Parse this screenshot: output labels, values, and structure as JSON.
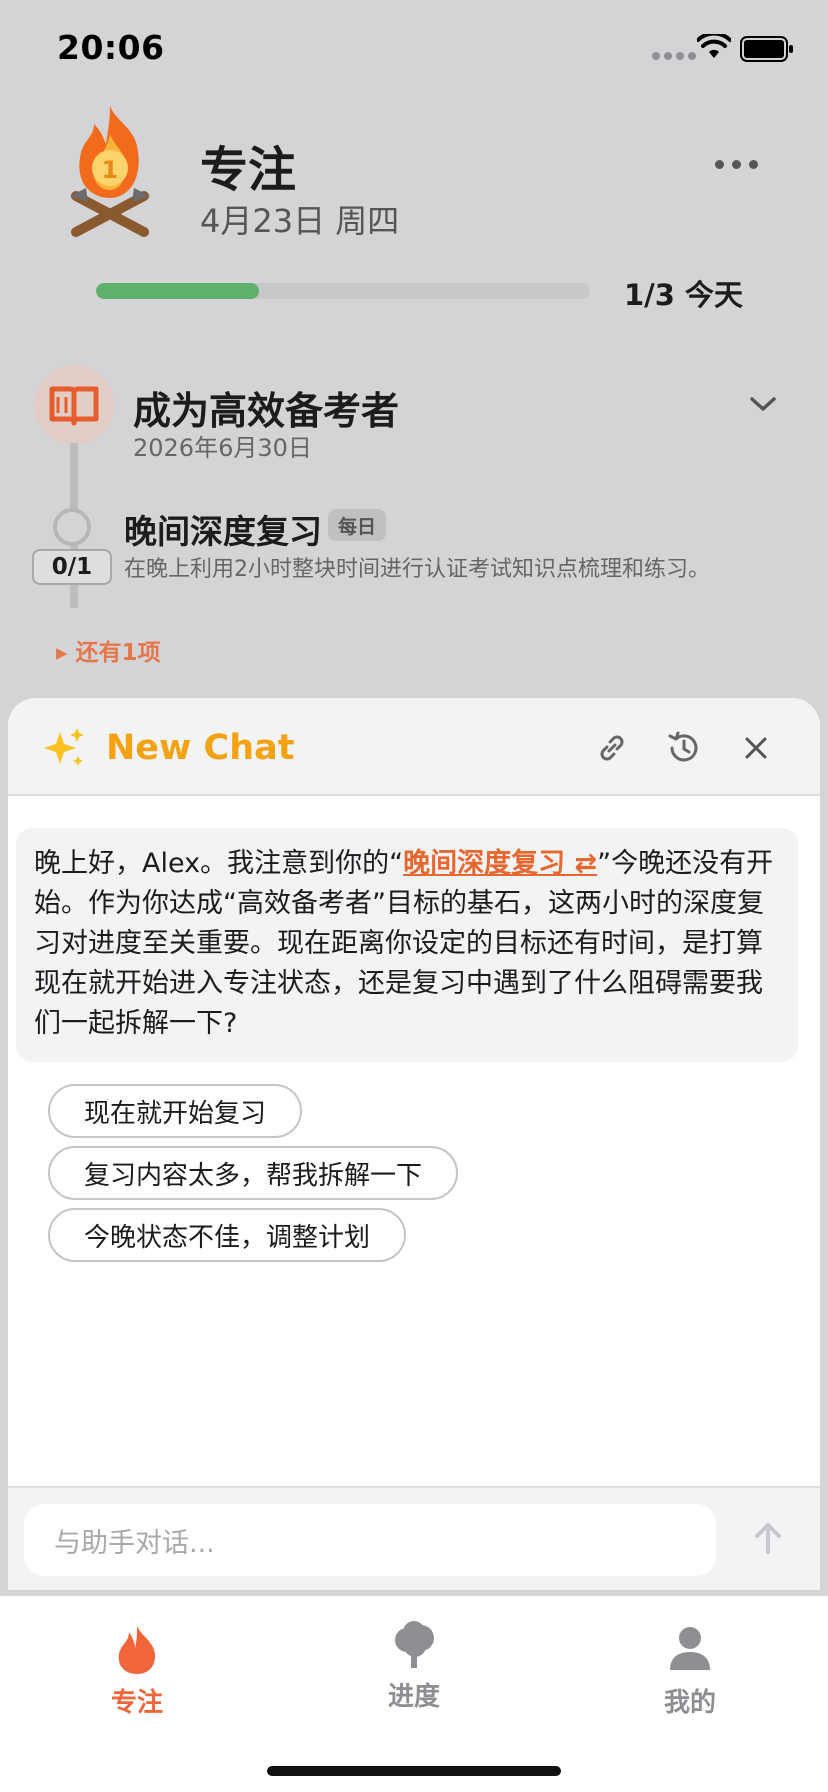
{
  "status_bar": {
    "time": "20:06"
  },
  "header": {
    "title": "专注",
    "date": "4月23日 周四",
    "progress_text": "1/3 今天",
    "progress_fraction": 0.33
  },
  "goal": {
    "title": "成为高效备考者",
    "due_date": "2026年6月30日",
    "task": {
      "title": "晚间深度复习",
      "tag": "每日",
      "count": "0/1",
      "description": "在晚上利用2小时整块时间进行认证考试知识点梳理和练习。"
    },
    "more_items": "▸ 还有1项"
  },
  "chat": {
    "title": "New Chat",
    "message": {
      "part1": "晚上好，Alex。我注意到你的“",
      "link": "晚间深度复习 ⇄",
      "part2": "”今晚还没有开始。作为你达成“高效备考者”目标的基石，这两小时的深度复习对进度至关重要。现在距离你设定的目标还有时间，是打算现在就开始进入专注状态，还是复习中遇到了什么阻碍需要我们一起拆解一下?"
    },
    "suggestions": [
      "现在就开始复习",
      "复习内容太多，帮我拆解一下",
      "今晚状态不佳，调整计划"
    ],
    "input_placeholder": "与助手对话..."
  },
  "tabs": [
    {
      "label": "专注",
      "icon": "flame-icon",
      "active": true
    },
    {
      "label": "进度",
      "icon": "tree-icon",
      "active": false
    },
    {
      "label": "我的",
      "icon": "person-icon",
      "active": false
    }
  ],
  "colors": {
    "accent_orange": "#f5a212",
    "active_tab": "#f0653a",
    "progress_green": "#5fb06b",
    "link_orange": "#e8672e"
  }
}
